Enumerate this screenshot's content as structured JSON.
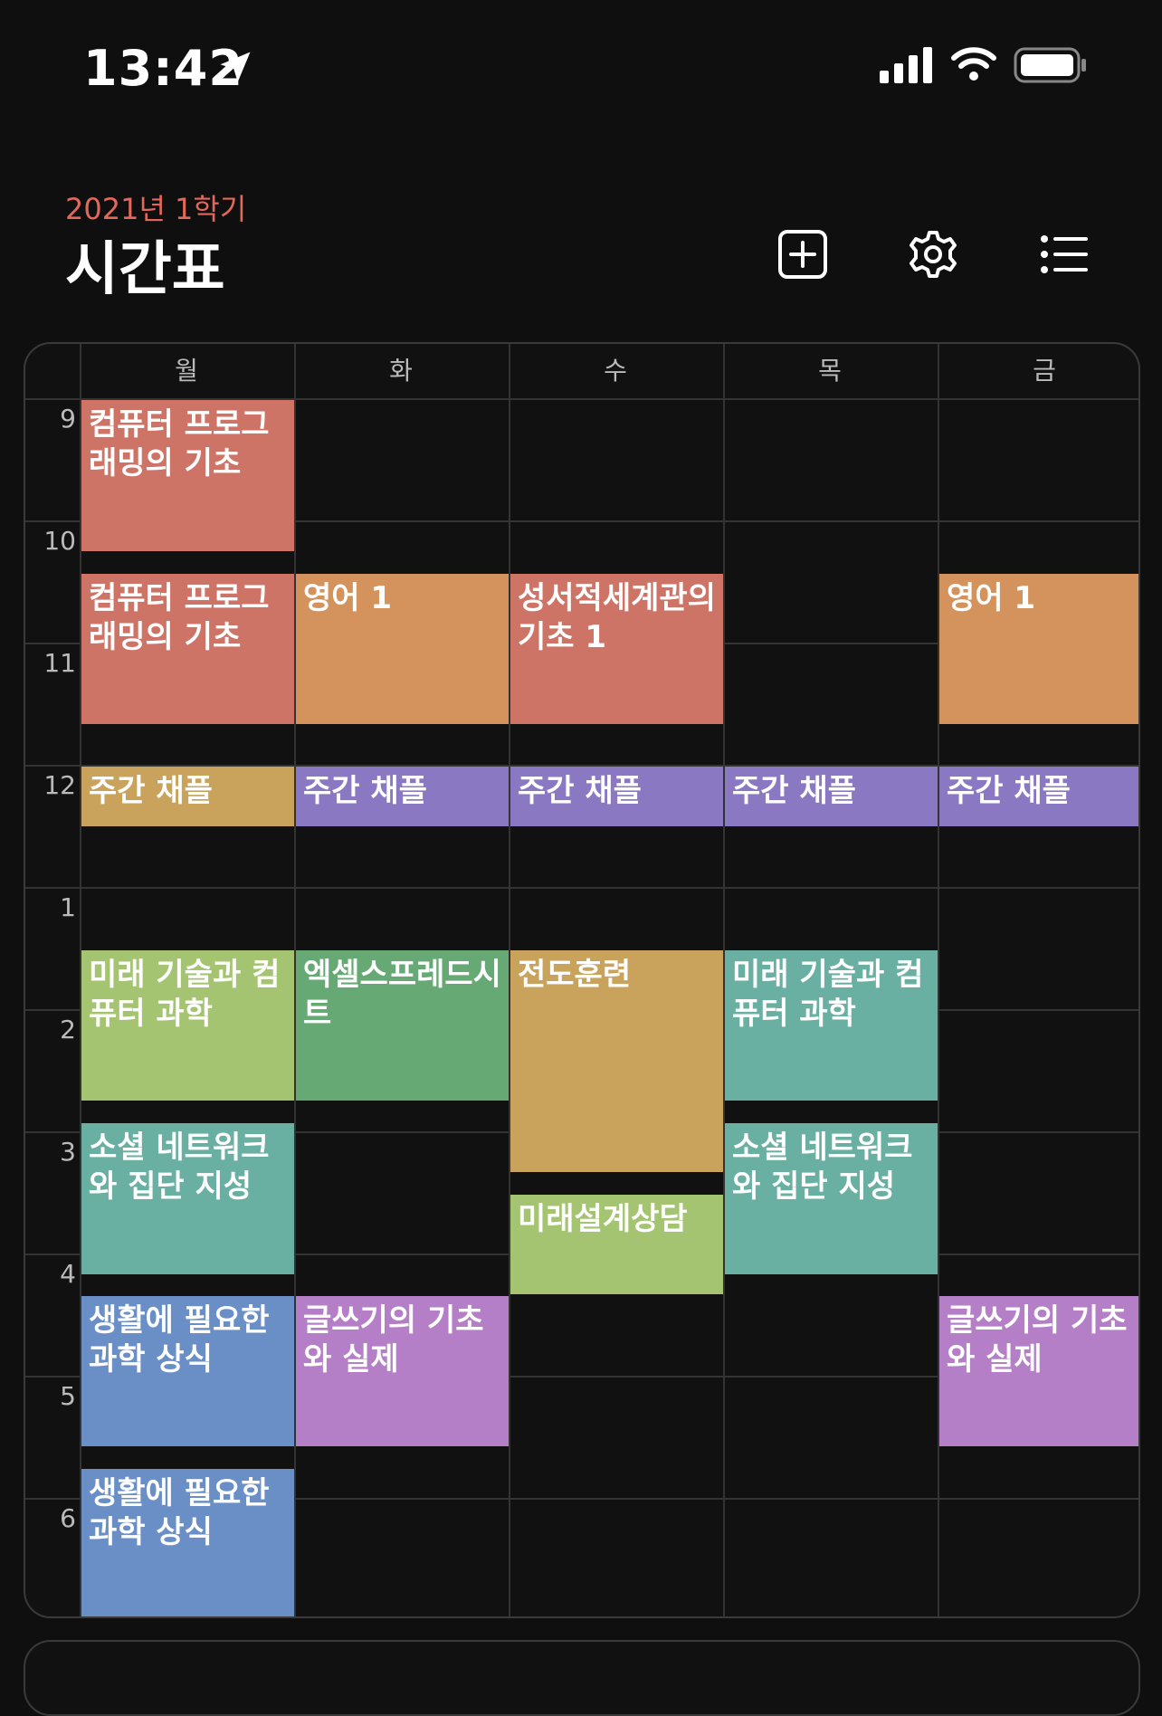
{
  "status": {
    "time": "13:42"
  },
  "header": {
    "semester": "2021년 1학기",
    "title": "시간표"
  },
  "days": [
    "월",
    "화",
    "수",
    "목",
    "금"
  ],
  "hours": [
    "9",
    "10",
    "11",
    "12",
    "1",
    "2",
    "3",
    "4",
    "5",
    "6"
  ],
  "blocks": [
    {
      "day": 0,
      "start": 9.0,
      "end": 10.25,
      "title": "컴퓨터 프로그래밍의 기초",
      "color": "#cd7466"
    },
    {
      "day": 0,
      "start": 10.42,
      "end": 11.67,
      "title": "컴퓨터 프로그래밍의 기초",
      "color": "#cd7466"
    },
    {
      "day": 1,
      "start": 10.42,
      "end": 11.67,
      "title": "영어 1",
      "color": "#d4935c"
    },
    {
      "day": 2,
      "start": 10.42,
      "end": 11.67,
      "title": "성서적세계관의 기초 1",
      "color": "#cd7466"
    },
    {
      "day": 4,
      "start": 10.42,
      "end": 11.67,
      "title": "영어 1",
      "color": "#d4935c"
    },
    {
      "day": 0,
      "start": 12.0,
      "end": 12.5,
      "title": "주간 채플",
      "color": "#c9a35b"
    },
    {
      "day": 1,
      "start": 12.0,
      "end": 12.5,
      "title": "주간 채플",
      "color": "#8b78c2"
    },
    {
      "day": 2,
      "start": 12.0,
      "end": 12.5,
      "title": "주간 채플",
      "color": "#8b78c2"
    },
    {
      "day": 3,
      "start": 12.0,
      "end": 12.5,
      "title": "주간 채플",
      "color": "#8b78c2"
    },
    {
      "day": 4,
      "start": 12.0,
      "end": 12.5,
      "title": "주간 채플",
      "color": "#8b78c2"
    },
    {
      "day": 0,
      "start": 13.5,
      "end": 14.75,
      "title": "미래 기술과 컴퓨터 과학",
      "color": "#a4c472"
    },
    {
      "day": 1,
      "start": 13.5,
      "end": 14.75,
      "title": "엑셀스프레드시트",
      "color": "#66a974"
    },
    {
      "day": 2,
      "start": 13.5,
      "end": 15.33,
      "title": "전도훈련",
      "color": "#c9a35b"
    },
    {
      "day": 3,
      "start": 13.5,
      "end": 14.75,
      "title": "미래 기술과 컴퓨터 과학",
      "color": "#69afa2"
    },
    {
      "day": 0,
      "start": 14.92,
      "end": 16.17,
      "title": "소셜 네트워크와 집단 지성",
      "color": "#69afa2"
    },
    {
      "day": 3,
      "start": 14.92,
      "end": 16.17,
      "title": "소셜 네트워크와 집단 지성",
      "color": "#69afa2"
    },
    {
      "day": 2,
      "start": 15.5,
      "end": 16.33,
      "title": "미래설계상담",
      "color": "#a4c472"
    },
    {
      "day": 0,
      "start": 16.33,
      "end": 17.58,
      "title": "생활에 필요한 과학 상식",
      "color": "#6a8fc7"
    },
    {
      "day": 1,
      "start": 16.33,
      "end": 17.58,
      "title": "글쓰기의 기초와 실제",
      "color": "#b47fc6"
    },
    {
      "day": 4,
      "start": 16.33,
      "end": 17.58,
      "title": "글쓰기의 기초와 실제",
      "color": "#b47fc6"
    },
    {
      "day": 0,
      "start": 17.75,
      "end": 19.0,
      "title": "생활에 필요한 과학 상식",
      "color": "#6a8fc7"
    }
  ]
}
